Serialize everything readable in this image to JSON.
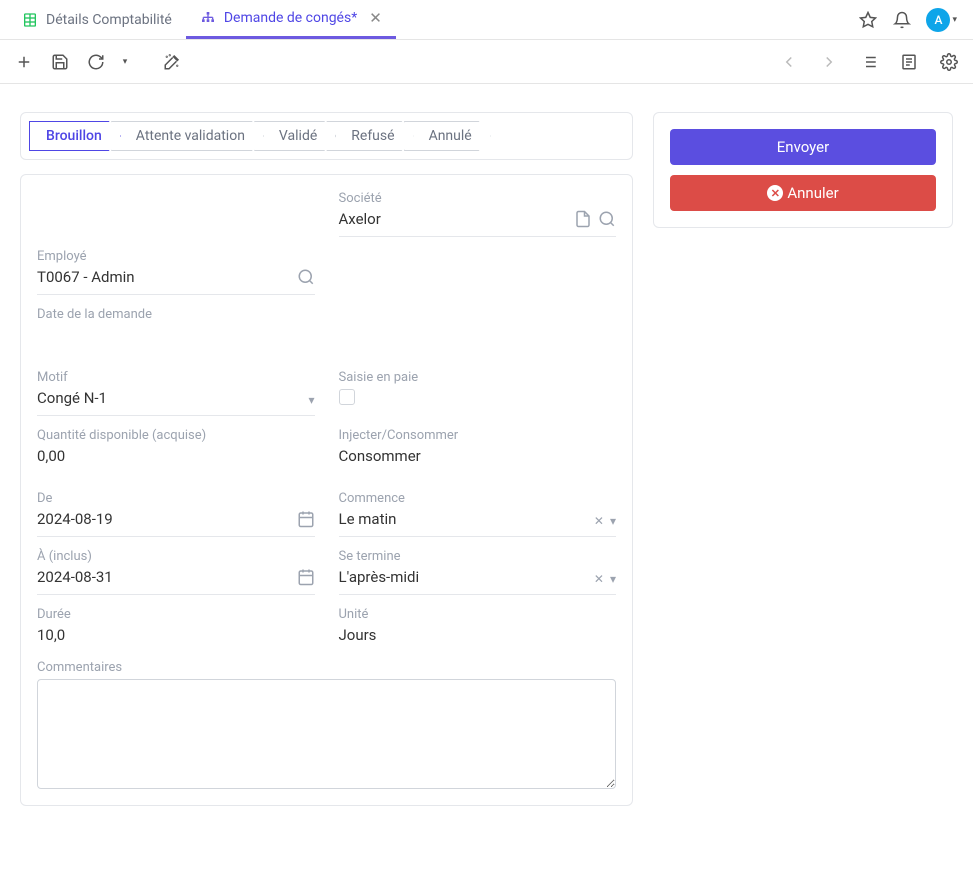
{
  "tabs": [
    {
      "label": "Détails Comptabilité",
      "active": false,
      "closable": false,
      "icon": "sheet"
    },
    {
      "label": "Demande de congés*",
      "active": true,
      "closable": true,
      "icon": "org"
    }
  ],
  "avatar_initial": "A",
  "process_steps": [
    {
      "label": "Brouillon",
      "active": true
    },
    {
      "label": "Attente validation",
      "active": false
    },
    {
      "label": "Validé",
      "active": false
    },
    {
      "label": "Refusé",
      "active": false
    },
    {
      "label": "Annulé",
      "active": false
    }
  ],
  "actions": {
    "send": "Envoyer",
    "cancel": "Annuler"
  },
  "form": {
    "societe_label": "Société",
    "societe_value": "Axelor",
    "employe_label": "Employé",
    "employe_value": "T0067 - Admin",
    "date_demande_label": "Date de la demande",
    "date_demande_value": "",
    "motif_label": "Motif",
    "motif_value": "Congé N-1",
    "saisie_label": "Saisie en paie",
    "quantite_label": "Quantité disponible (acquise)",
    "quantite_value": "0,00",
    "injecter_label": "Injecter/Consommer",
    "injecter_value": "Consommer",
    "de_label": "De",
    "de_value": "2024-08-19",
    "commence_label": "Commence",
    "commence_value": "Le matin",
    "a_label": "À (inclus)",
    "a_value": "2024-08-31",
    "se_termine_label": "Se termine",
    "se_termine_value": "L'après-midi",
    "duree_label": "Durée",
    "duree_value": "10,0",
    "unite_label": "Unité",
    "unite_value": "Jours",
    "commentaires_label": "Commentaires"
  }
}
